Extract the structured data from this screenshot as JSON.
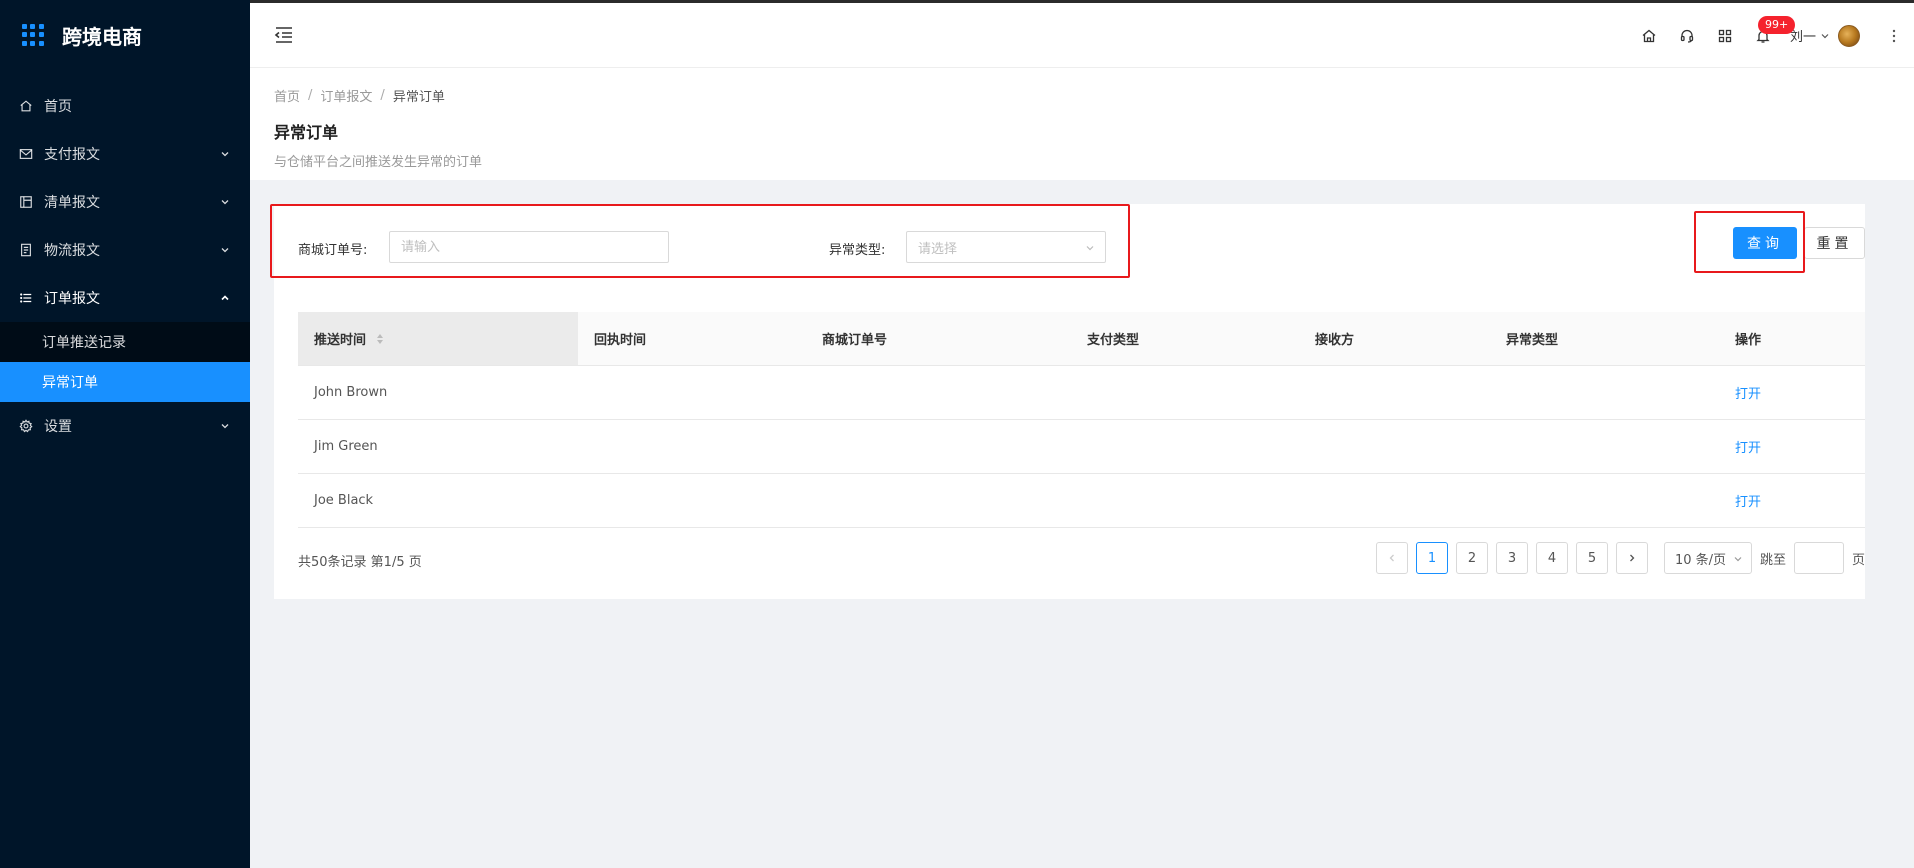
{
  "app": {
    "title": "跨境电商"
  },
  "sidebar": {
    "items": [
      {
        "label": "首页",
        "icon": "home-icon"
      },
      {
        "label": "支付报文",
        "icon": "mail-icon"
      },
      {
        "label": "清单报文",
        "icon": "layout-icon"
      },
      {
        "label": "物流报文",
        "icon": "file-icon"
      },
      {
        "label": "订单报文",
        "icon": "list-icon"
      },
      {
        "label": "设置",
        "icon": "gear-icon"
      }
    ],
    "submenu": [
      {
        "label": "订单推送记录"
      },
      {
        "label": "异常订单"
      }
    ],
    "accent": "#1890ff",
    "background": "#001529"
  },
  "header": {
    "badge": "99+",
    "user_name": "刘一"
  },
  "breadcrumb": [
    "首页",
    "订单报文",
    "异常订单"
  ],
  "page": {
    "title": "异常订单",
    "description": "与仓储平台之间推送发生异常的订单"
  },
  "filters": {
    "order_no_label": "商城订单号:",
    "order_no_placeholder": "请输入",
    "exception_type_label": "异常类型:",
    "exception_type_placeholder": "请选择",
    "query_button": "查询",
    "reset_button": "重置"
  },
  "table": {
    "columns": [
      "推送时间",
      "回执时间",
      "商城订单号",
      "支付类型",
      "接收方",
      "异常类型",
      "操作"
    ],
    "rows": [
      {
        "push_time": "John Brown",
        "action": "打开"
      },
      {
        "push_time": "Jim Green",
        "action": "打开"
      },
      {
        "push_time": "Joe Black",
        "action": "打开"
      }
    ]
  },
  "pagination": {
    "total_text": "共50条记录 第1/5 页",
    "pages": [
      "1",
      "2",
      "3",
      "4",
      "5"
    ],
    "current": "1",
    "page_size": "10 条/页",
    "jump_label": "跳至",
    "page_suffix": "页"
  },
  "highlight_color": "#e8191c"
}
